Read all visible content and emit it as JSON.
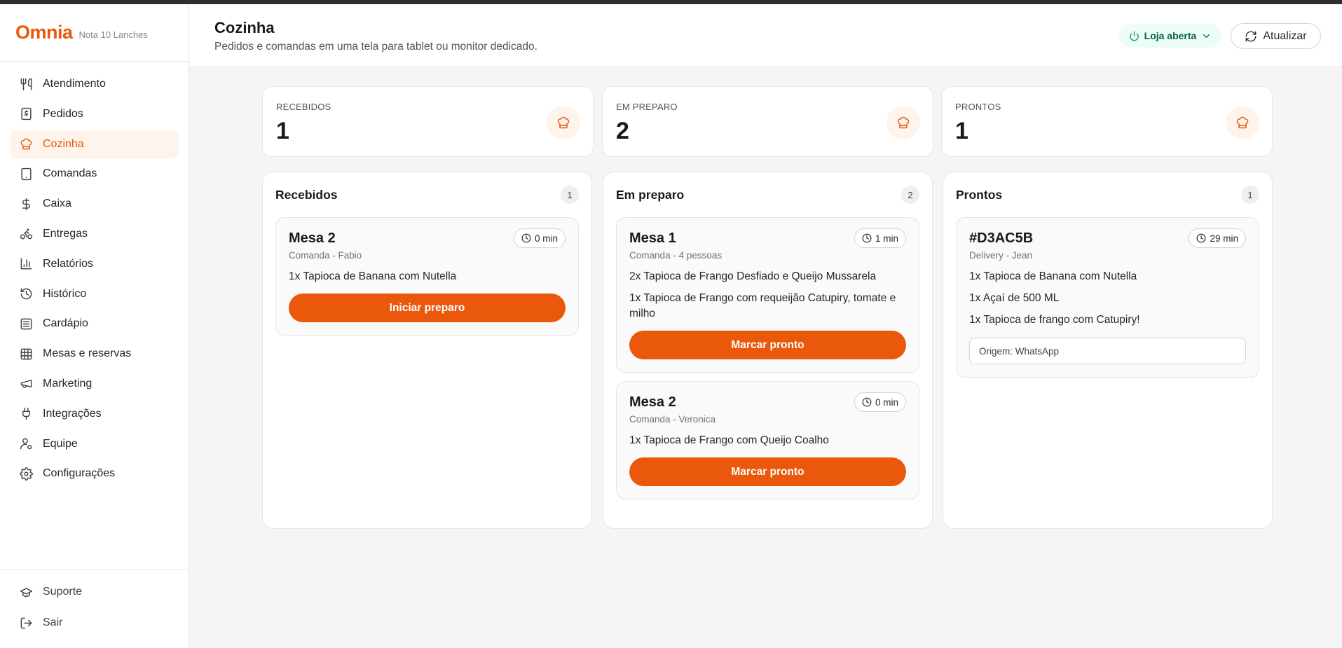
{
  "brand": {
    "logo": "Omnia",
    "store_name": "Nota 10 Lanches"
  },
  "sidebar": {
    "items": [
      {
        "label": "Atendimento",
        "icon": "utensils-icon"
      },
      {
        "label": "Pedidos",
        "icon": "receipt-icon"
      },
      {
        "label": "Cozinha",
        "icon": "chef-hat-icon",
        "active": true
      },
      {
        "label": "Comandas",
        "icon": "tablet-icon"
      },
      {
        "label": "Caixa",
        "icon": "dollar-icon"
      },
      {
        "label": "Entregas",
        "icon": "bike-icon"
      },
      {
        "label": "Relatórios",
        "icon": "bar-chart-icon"
      },
      {
        "label": "Histórico",
        "icon": "history-icon"
      },
      {
        "label": "Cardápio",
        "icon": "menu-list-icon"
      },
      {
        "label": "Mesas e reservas",
        "icon": "grid-icon"
      },
      {
        "label": "Marketing",
        "icon": "megaphone-icon"
      },
      {
        "label": "Integrações",
        "icon": "plug-icon"
      },
      {
        "label": "Equipe",
        "icon": "users-icon"
      },
      {
        "label": "Configurações",
        "icon": "gear-icon"
      }
    ],
    "bottom": [
      {
        "label": "Suporte",
        "icon": "graduation-cap-icon"
      },
      {
        "label": "Sair",
        "icon": "logout-icon"
      }
    ]
  },
  "header": {
    "title": "Cozinha",
    "subtitle": "Pedidos e comandas em uma tela para tablet ou monitor dedicado.",
    "status_label": "Loja aberta",
    "refresh_label": "Atualizar"
  },
  "stats": [
    {
      "label": "RECEBIDOS",
      "value": "1"
    },
    {
      "label": "EM PREPARO",
      "value": "2"
    },
    {
      "label": "PRONTOS",
      "value": "1"
    }
  ],
  "columns": [
    {
      "title": "Recebidos",
      "count": "1",
      "cards": [
        {
          "title": "Mesa 2",
          "subtitle": "Comanda - Fabio",
          "timer": "0 min",
          "items": [
            "1x Tapioca de Banana com Nutella"
          ],
          "action": "Iniciar preparo"
        }
      ]
    },
    {
      "title": "Em preparo",
      "count": "2",
      "cards": [
        {
          "title": "Mesa 1",
          "subtitle": "Comanda - 4 pessoas",
          "timer": "1 min",
          "items": [
            "2x Tapioca de Frango Desfiado e Queijo Mussarela",
            "1x Tapioca de Frango com requeijão Catupiry, tomate e milho"
          ],
          "action": "Marcar pronto"
        },
        {
          "title": "Mesa 2",
          "subtitle": "Comanda - Veronica",
          "timer": "0 min",
          "items": [
            "1x Tapioca de Frango com Queijo Coalho"
          ],
          "action": "Marcar pronto"
        }
      ]
    },
    {
      "title": "Prontos",
      "count": "1",
      "cards": [
        {
          "title": "#D3AC5B",
          "subtitle": "Delivery - Jean",
          "timer": "29 min",
          "items": [
            "1x Tapioca de Banana com Nutella",
            "1x Açaí de 500 ML",
            "1x Tapioca de frango com Catupiry!"
          ],
          "origin": "Origem: WhatsApp"
        }
      ]
    }
  ],
  "colors": {
    "accent": "#ea580c",
    "accent_soft": "#fff4ec",
    "status_bg": "#ecfdf5",
    "status_text": "#065f46"
  }
}
